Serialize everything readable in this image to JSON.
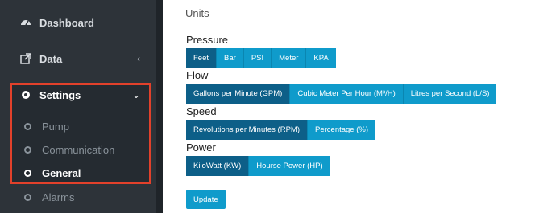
{
  "sidebar": {
    "items": [
      {
        "label": "Dashboard",
        "icon": "dashboard-icon"
      },
      {
        "label": "Data",
        "icon": "external-link-icon",
        "chevron": "‹"
      },
      {
        "label": "Settings",
        "icon": "gear-icon",
        "chevron": "⌄"
      }
    ],
    "settings_sub": [
      {
        "label": "Pump"
      },
      {
        "label": "Communication"
      },
      {
        "label": "General",
        "active": true
      }
    ],
    "after": [
      {
        "label": "Alarms"
      }
    ]
  },
  "main": {
    "title": "Units",
    "sections": [
      {
        "label": "Pressure",
        "options": [
          "Feet",
          "Bar",
          "PSI",
          "Meter",
          "KPA"
        ],
        "selected": "Feet"
      },
      {
        "label": "Flow",
        "options": [
          "Gallons per Minute (GPM)",
          "Cubic Meter Per Hour (M³/H)",
          "Litres per Second (L/S)"
        ],
        "selected": "Gallons per Minute (GPM)"
      },
      {
        "label": "Speed",
        "options": [
          "Revolutions per Minutes (RPM)",
          "Percentage (%)"
        ],
        "selected": "Revolutions per Minutes (RPM)"
      },
      {
        "label": "Power",
        "options": [
          "KiloWatt (KW)",
          "Hourse Power (HP)"
        ],
        "selected": "KiloWatt (KW)"
      }
    ],
    "update_label": "Update"
  },
  "colors": {
    "sidebar_bg": "#2d3339",
    "accent": "#0f9bcb",
    "accent_selected": "#0d5f88",
    "highlight": "#e2412b"
  }
}
